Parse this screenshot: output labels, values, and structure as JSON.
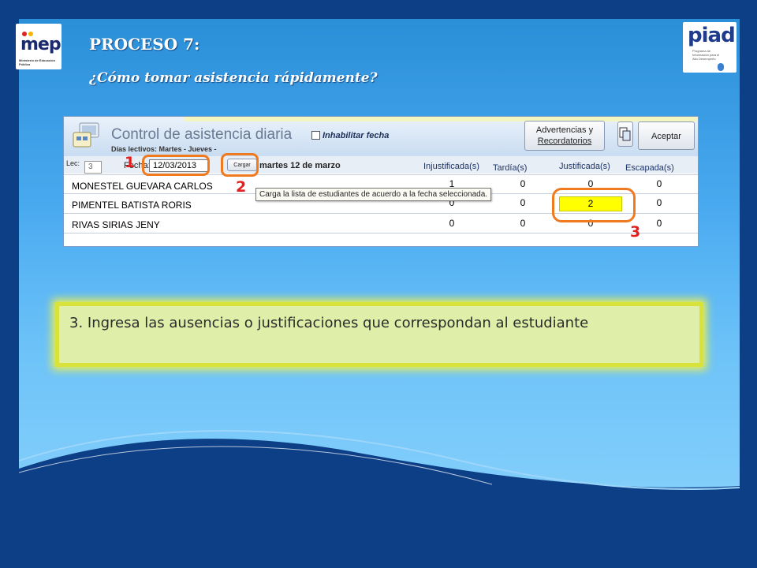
{
  "slide": {
    "title": "PROCESO 7:",
    "subtitle": "¿Cómo tomar asistencia rápidamente?",
    "logos": {
      "mep_text": "mep",
      "mep_sub": "Ministerio de Educación Pública",
      "piad_text": "piad",
      "piad_sub": "Programa de Información para el Alto Desempeño"
    },
    "markers": [
      "1",
      "2",
      "3"
    ],
    "instruction": "3. Ingresa las ausencias o justificaciones que correspondan al estudiante",
    "colors": {
      "accent_orange": "#f07a20",
      "marker_red": "#e21e1e",
      "highlight_yellow": "#ffff00",
      "note_bg": "#dfeea8"
    }
  },
  "app": {
    "title": "Control de asistencia diaria",
    "days": "Días lectivos: Martes - Jueves -",
    "disable_date_label": "Inhabilitar fecha",
    "buttons": {
      "warnings_line1": "Advertencias y",
      "warnings_line2": "Recordatorios",
      "accept": "Aceptar"
    },
    "filters": {
      "lec_label": "Lec:",
      "lec_value": "3",
      "fecha_label": "Fecha:",
      "fecha_value": "12/03/2013",
      "load_button": "Cargar",
      "date_text": "martes 12 de marzo"
    },
    "tooltip": "Carga la lista de estudiantes de acuerdo a la fecha seleccionada.",
    "columns": [
      "Injustificada(s)",
      "Tardía(s)",
      "Justificada(s)",
      "Escapada(s)"
    ],
    "students": [
      {
        "name": "MONESTEL GUEVARA CARLOS",
        "injustificadas": "1",
        "tardias": "0",
        "justificadas": "0",
        "escapadas": "0"
      },
      {
        "name": "PIMENTEL BATISTA RORIS",
        "injustificadas": "0",
        "tardias": "0",
        "justificadas": "2",
        "escapadas": "0"
      },
      {
        "name": "RIVAS SIRIAS JENY",
        "injustificadas": "0",
        "tardias": "0",
        "justificadas": "0",
        "escapadas": "0"
      }
    ]
  }
}
